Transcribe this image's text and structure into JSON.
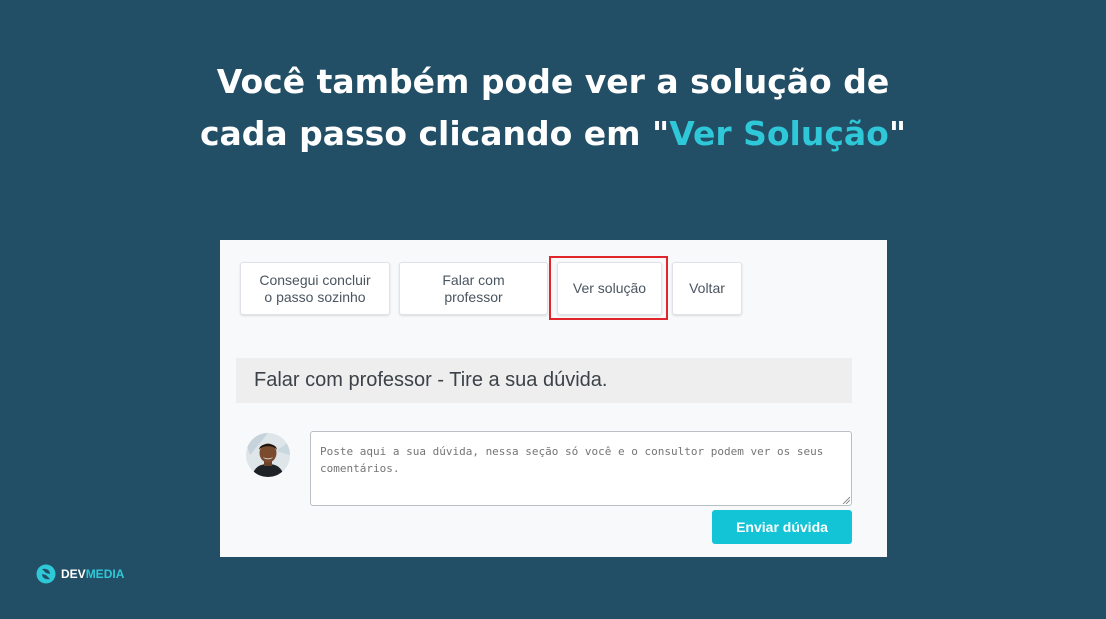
{
  "headline": {
    "line1": "Você também pode ver a solução de",
    "line2_prefix": "cada passo clicando em \"",
    "line2_accent": "Ver Solução",
    "line2_suffix": "\""
  },
  "actions": {
    "solved_alone": "Consegui concluir\no passo sozinho",
    "talk_to_teacher": "Falar com\nprofessor",
    "see_solution": "Ver solução",
    "back": "Voltar"
  },
  "section": {
    "title": "Falar com professor - Tire a sua dúvida."
  },
  "question": {
    "placeholder": "Poste aqui a sua dúvida, nessa seção só você e o consultor podem ver os seus comentários.",
    "value": "",
    "submit_label": "Enviar dúvida"
  },
  "brand": {
    "part1": "DEV",
    "part2": "MEDIA"
  },
  "colors": {
    "background": "#224f66",
    "accent": "#2fc8d8",
    "highlight_box": "#e0262b",
    "submit_button": "#12c4d6"
  },
  "icons": {
    "avatar": "user-avatar-photo",
    "logo": "devmedia-logo-icon"
  }
}
